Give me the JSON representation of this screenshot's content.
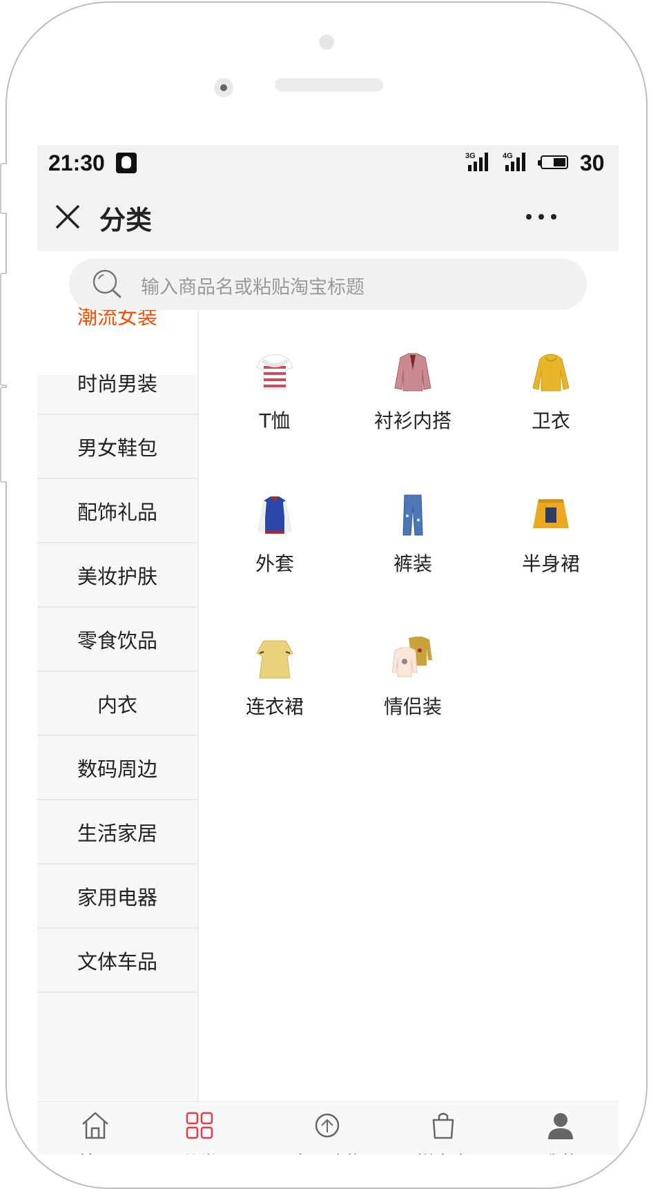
{
  "status_bar": {
    "time": "21:30",
    "net1": "3G",
    "net2": "4G",
    "battery": "30"
  },
  "nav": {
    "title": "分类"
  },
  "search": {
    "placeholder": "输入商品名或粘贴淘宝标题"
  },
  "categories": [
    {
      "label": "潮流女装",
      "active": true
    },
    {
      "label": "时尚男装"
    },
    {
      "label": "男女鞋包"
    },
    {
      "label": "配饰礼品"
    },
    {
      "label": "美妆护肤"
    },
    {
      "label": "零食饮品"
    },
    {
      "label": "内衣"
    },
    {
      "label": "数码周边"
    },
    {
      "label": "生活家居"
    },
    {
      "label": "家用电器"
    },
    {
      "label": "文体车品"
    }
  ],
  "subcategories": [
    {
      "label": "T恤",
      "icon": "striped-tshirt-icon",
      "color": "#d14b57"
    },
    {
      "label": "衬衫内搭",
      "icon": "blouse-icon",
      "color": "#b86b72"
    },
    {
      "label": "卫衣",
      "icon": "hoodie-icon",
      "color": "#e8b52a"
    },
    {
      "label": "外套",
      "icon": "varsity-jacket-icon",
      "color": "#2a47a8"
    },
    {
      "label": "裤装",
      "icon": "jeans-icon",
      "color": "#4d78b8"
    },
    {
      "label": "半身裙",
      "icon": "skirt-icon",
      "color": "#eaa91e"
    },
    {
      "label": "连衣裙",
      "icon": "dress-icon",
      "color": "#ead27a"
    },
    {
      "label": "情侣装",
      "icon": "couple-sweaters-icon",
      "color": "#c9a23c"
    }
  ],
  "tabs": [
    {
      "label": "首页",
      "icon": "home-icon"
    },
    {
      "label": "分类",
      "icon": "grid-icon",
      "active": true
    },
    {
      "label": "全网购物",
      "icon": "rebate-icon"
    },
    {
      "label": "拼多多",
      "icon": "shopping-bag-icon"
    },
    {
      "label": "我的",
      "icon": "user-icon"
    }
  ],
  "colors": {
    "accent": "#ff4c00",
    "tab_active": "#e83a46"
  }
}
